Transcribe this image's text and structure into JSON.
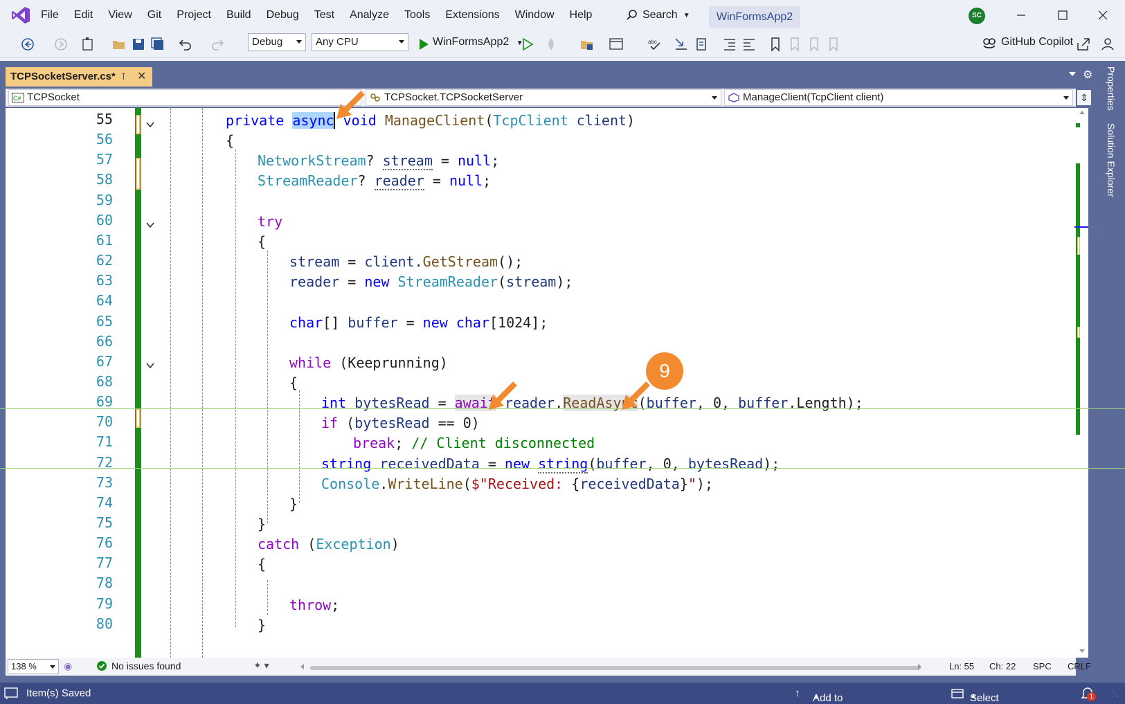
{
  "menu": {
    "items": [
      "File",
      "Edit",
      "View",
      "Git",
      "Project",
      "Build",
      "Debug",
      "Test",
      "Analyze",
      "Tools",
      "Extensions",
      "Window",
      "Help"
    ],
    "search_label": "Search",
    "solution_name": "WinFormsApp2",
    "avatar_initials": "SC"
  },
  "toolbar": {
    "configuration": "Debug",
    "platform": "Any CPU",
    "run_target": "WinFormsApp2",
    "copilot_label": "GitHub Copilot"
  },
  "document": {
    "tab_title": "TCPSocketServer.cs*",
    "nav_project": "TCPSocket",
    "nav_class": "TCPSocket.TCPSocketServer",
    "nav_member": "ManageClient(TcpClient client)"
  },
  "side_tabs": [
    "Properties",
    "Solution Explorer"
  ],
  "code": {
    "line_numbers": [
      "55",
      "56",
      "57",
      "58",
      "59",
      "60",
      "61",
      "62",
      "63",
      "64",
      "65",
      "66",
      "67",
      "68",
      "69",
      "70",
      "71",
      "72",
      "73",
      "74",
      "75",
      "76",
      "77",
      "78",
      "79",
      "80"
    ],
    "current_line": "55"
  },
  "annotation": {
    "step_number": "9"
  },
  "editor_footer": {
    "zoom": "138 %",
    "issues": "No issues found",
    "ln": "Ln: 55",
    "ch": "Ch: 22",
    "spc": "SPC",
    "eol": "CRLF"
  },
  "status_bar": {
    "message": "Item(s) Saved",
    "source_control": "Add to Source Control",
    "repository": "Select Repository",
    "notification_count": "1"
  }
}
